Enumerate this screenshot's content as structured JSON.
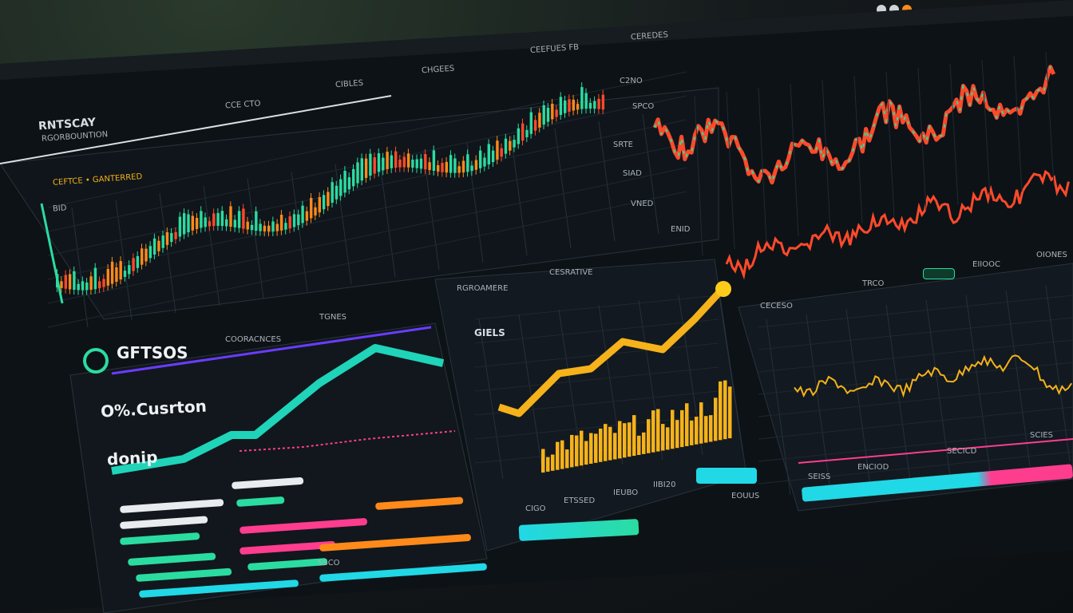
{
  "top_dots": [
    "window-dot-1",
    "window-dot-2",
    "window-dot-3"
  ],
  "header": {
    "title": "RNTSCAY",
    "subtitle": "RGORBOUNTION",
    "label_a": "CCE CTO",
    "label_b": "CIBLES",
    "label_c": "CHGEES",
    "label_d": "CEEFUES FB",
    "label_e": "CEREDES"
  },
  "main_chart": {
    "legend": "CEFTCE • GANTERRED",
    "axis_top_left": "BID"
  },
  "right_chart": {
    "labels": [
      "C2NO",
      "SPCO",
      "SRTE",
      "SIAD",
      "ENID",
      "VNED"
    ]
  },
  "left_card": {
    "title": "GFTSOS",
    "tab_1": "COORACNCES",
    "tab_2": "TGNES",
    "headline": "O%.Cusrton",
    "sub": "donip",
    "footer": "SSCO"
  },
  "mid_card": {
    "title": "RGROAMERE",
    "header": "CESRATIVE",
    "name": "GIELS",
    "stats": [
      "CIGO",
      "ETSSED",
      "IEUBO",
      "IIBI20",
      "EOUUS"
    ]
  },
  "right_card": {
    "label_a": "CECESO",
    "label_b": "TRCO",
    "label_c": "EIIOOC",
    "label_d": "OIONES",
    "stats": [
      "SEISS",
      "ENCIOD",
      "SECICD",
      "SCIES"
    ]
  },
  "colors": {
    "green": "#2bdca0",
    "red": "#ff4a2a",
    "orange": "#ff8a1a",
    "yellow": "#f5b21a",
    "cyan": "#21d8e6",
    "pink": "#ff3d8f",
    "white": "#e8ecef"
  }
}
